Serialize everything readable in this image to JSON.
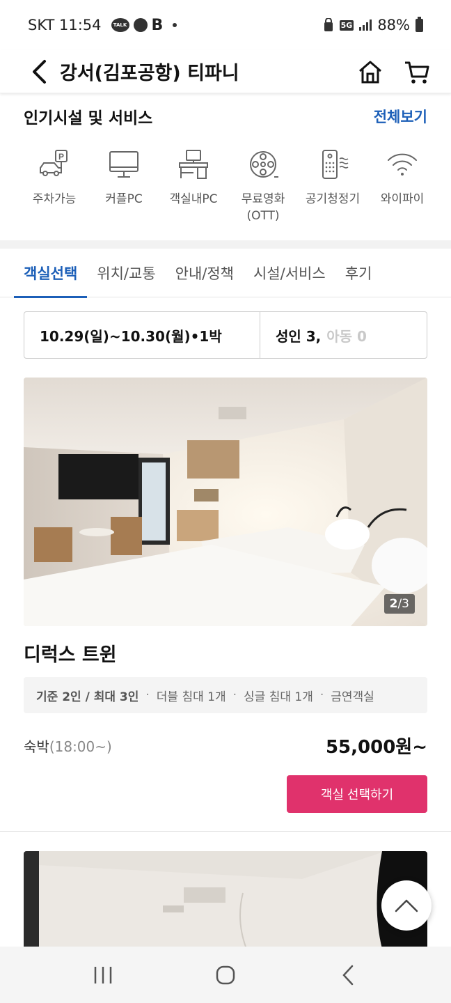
{
  "status_bar": {
    "carrier_time": "SKT 11:54",
    "talk_badge": "TALK",
    "b_icon": "B",
    "network": "5G",
    "battery": "88%"
  },
  "header": {
    "title": "강서(김포공항) 티파니",
    "icons": [
      "back-arrow-icon",
      "home-icon",
      "cart-icon"
    ]
  },
  "facilities": {
    "title": "인기시설 및 서비스",
    "see_all": "전체보기",
    "items": [
      {
        "label": "주차가능",
        "icon": "parking-icon"
      },
      {
        "label": "커플PC",
        "icon": "monitor-icon"
      },
      {
        "label": "객실내PC",
        "icon": "desk-pc-icon"
      },
      {
        "label": "무료영화\n(OTT)",
        "icon": "film-reel-icon"
      },
      {
        "label": "공기청정기",
        "icon": "air-purifier-icon"
      },
      {
        "label": "와이파이",
        "icon": "wifi-icon"
      }
    ]
  },
  "tabs": [
    {
      "label": "객실선택",
      "active": true
    },
    {
      "label": "위치/교통",
      "active": false
    },
    {
      "label": "안내/정책",
      "active": false
    },
    {
      "label": "시설/서비스",
      "active": false
    },
    {
      "label": "후기",
      "active": false
    }
  ],
  "booking": {
    "dates": "10.29(일)~10.30(월)•1박",
    "adults": "성인 3,",
    "children": "아동 0"
  },
  "room": {
    "photo_current": "2",
    "photo_total": "/3",
    "name": "디럭스 트윈",
    "capacity": "기준 2인 / 최대 3인",
    "sep": "·",
    "bed_double": "더블 침대 1개",
    "bed_single": "싱글 침대 1개",
    "smoking": "금연객실",
    "stay_label": "숙박",
    "stay_time": "(18:00~)",
    "price": "55,000원~",
    "select_button": "객실 선택하기"
  },
  "colors": {
    "accent_blue": "#1c5fb8",
    "button_pink": "#e0326c"
  }
}
